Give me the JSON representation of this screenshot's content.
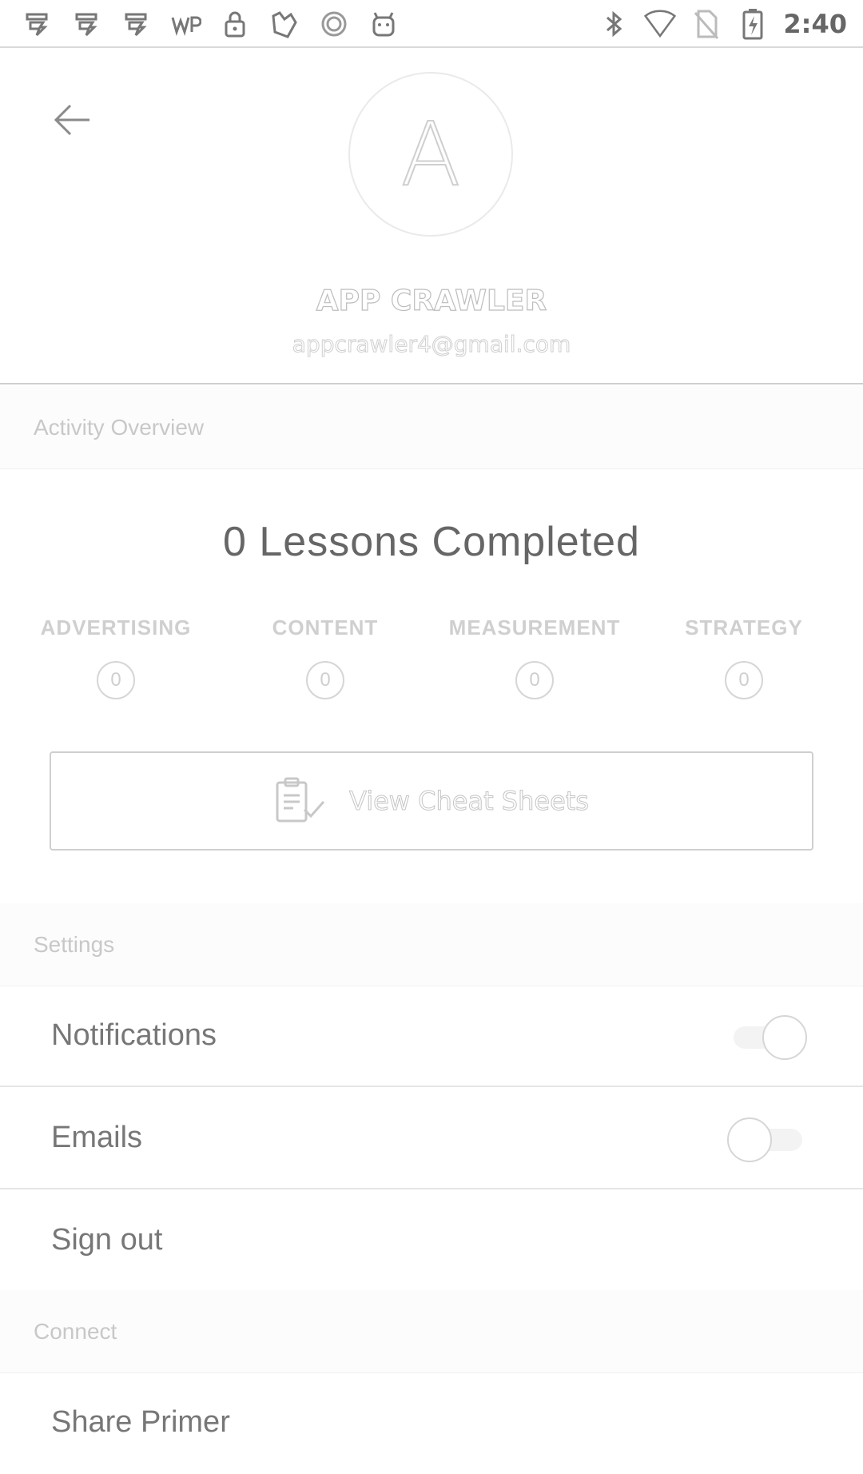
{
  "status_bar": {
    "time": "2:40",
    "left_icons": [
      "app-notification-icon",
      "app-notification-icon",
      "app-notification-icon",
      "wp-icon",
      "lock-icon",
      "photo-icon",
      "sync-icon",
      "android-icon"
    ],
    "right_icons": [
      "bluetooth-icon",
      "wifi-icon",
      "no-sim-icon",
      "battery-charging-icon"
    ]
  },
  "profile": {
    "avatar_letter": "A",
    "name": "APP CRAWLER",
    "email": "appcrawler4@gmail.com"
  },
  "activity": {
    "section_title": "Activity Overview",
    "lessons_completed": "0 Lessons Completed",
    "categories": [
      {
        "label": "ADVERTISING",
        "count": "0"
      },
      {
        "label": "CONTENT",
        "count": "0"
      },
      {
        "label": "MEASUREMENT",
        "count": "0"
      },
      {
        "label": "STRATEGY",
        "count": "0"
      }
    ],
    "cheat_sheets_label": "View Cheat Sheets"
  },
  "settings": {
    "section_title": "Settings",
    "notifications": {
      "label": "Notifications",
      "enabled": true
    },
    "emails": {
      "label": "Emails",
      "enabled": false
    },
    "sign_out_label": "Sign out"
  },
  "connect": {
    "section_title": "Connect",
    "share_label": "Share Primer"
  },
  "colors": {
    "background": "#ffffff",
    "text": "#666666",
    "muted": "#cfcfcf",
    "divider": "#e5e5e5"
  }
}
